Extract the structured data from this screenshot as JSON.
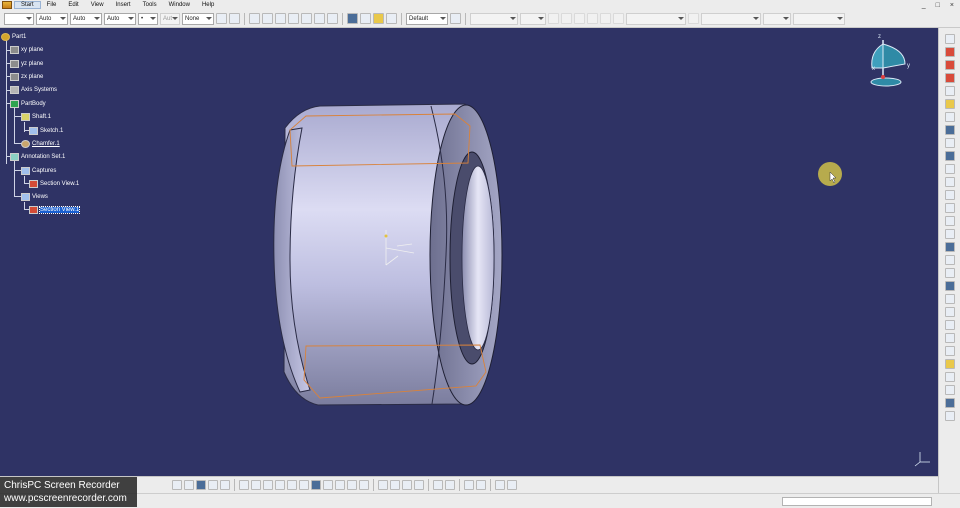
{
  "menu": {
    "items": [
      "Start",
      "File",
      "Edit",
      "View",
      "Insert",
      "Tools",
      "Window",
      "Help"
    ],
    "window_controls": [
      "_",
      "□",
      "×"
    ]
  },
  "toolbar": {
    "linetype": "",
    "thickness": "Auto",
    "linetype2": "Auto",
    "color": "Auto",
    "point": "•",
    "autofill": "Aut",
    "none": "None",
    "style": "Default"
  },
  "tree": {
    "root": "Part1",
    "xy": "xy plane",
    "yz": "yz plane",
    "zx": "zx plane",
    "axis": "Axis Systems",
    "partbody": "PartBody",
    "shaft": "Shaft.1",
    "sketch": "Sketch.1",
    "chamfer": "Chamfer.1",
    "annset": "Annotation Set.1",
    "captures": "Captures",
    "section_capture": "Section View.1",
    "views": "Views",
    "section_view": "Section View.1"
  },
  "compass": {
    "x": "x",
    "y": "y",
    "z": "z"
  },
  "watermark": {
    "line1": "ChrisPC Screen Recorder",
    "line2": "www.pcscreenrecorder.com"
  },
  "colors": {
    "viewport": "#2f3365",
    "part_fill": "#b9bbe0",
    "edge_orange": "#d9823a",
    "selection": "#1a5fd0"
  }
}
